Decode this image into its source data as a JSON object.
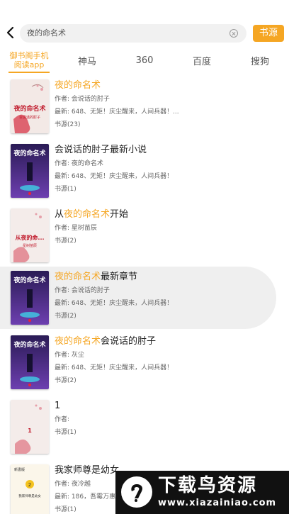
{
  "search": {
    "query": "夜的命名术",
    "source_button": "书源"
  },
  "tabs": [
    {
      "line1": "御书阁手机",
      "line2": "阅读app"
    },
    {
      "label": "神马"
    },
    {
      "label": "360"
    },
    {
      "label": "百度"
    },
    {
      "label": "搜狗"
    }
  ],
  "results": [
    {
      "title_prefix": "",
      "title_highlight": "夜的命名术",
      "title_suffix": "",
      "author": "作者: 会说话的肘子",
      "latest": "最新: 648、无矩！庆尘醒来，人间兵器！...",
      "source": "书源(23)",
      "cover_text": "夜的命名术",
      "cover_sub": "会说话的肘子"
    },
    {
      "title_prefix": "会说话的肘子最新小说",
      "title_highlight": "",
      "title_suffix": "",
      "author": "作者: 夜的命名术",
      "latest": "最新: 648、无矩！庆尘醒来，人间兵器！",
      "source": "书源(1)",
      "cover_text": "夜的命名术"
    },
    {
      "title_prefix": "从",
      "title_highlight": "夜的命名术",
      "title_suffix": "开始",
      "author": "作者: 星树苗辰",
      "latest": "",
      "source": "书源(2)",
      "cover_text": "从夜的命...",
      "cover_sub": "星树苗辰"
    },
    {
      "title_prefix": "",
      "title_highlight": "夜的命名术",
      "title_suffix": "最新章节",
      "author": "作者: 会说话的肘子",
      "latest": "最新: 648、无矩！庆尘醒来，人间兵器！",
      "source": "书源(2)",
      "cover_text": "夜的命名术"
    },
    {
      "title_prefix": "",
      "title_highlight": "夜的命名术",
      "title_suffix": "会说话的肘子",
      "author": "作者: 灰尘",
      "latest": "最新: 648、无矩！庆尘醒来，人间兵器！",
      "source": "书源(2)",
      "cover_text": "夜的命名术"
    },
    {
      "title_prefix": "1",
      "title_highlight": "",
      "title_suffix": "",
      "author": "作者:",
      "latest": "",
      "source": "书源(1)",
      "cover_text": "1"
    },
    {
      "title_prefix": "我家师尊是幼女",
      "title_highlight": "",
      "title_suffix": "",
      "author": "作者: 夜冷越",
      "latest": "最新: 186，吾霉万惠...",
      "source": "书源(1)",
      "cover_text": "我家师尊是幼女",
      "cover_badge": "新書版"
    }
  ],
  "watermark": {
    "title": "下载鸟资源",
    "url": "www.xiazainiao.com"
  },
  "colors": {
    "accent": "#f5a623",
    "highlight_row": "#efefef"
  }
}
